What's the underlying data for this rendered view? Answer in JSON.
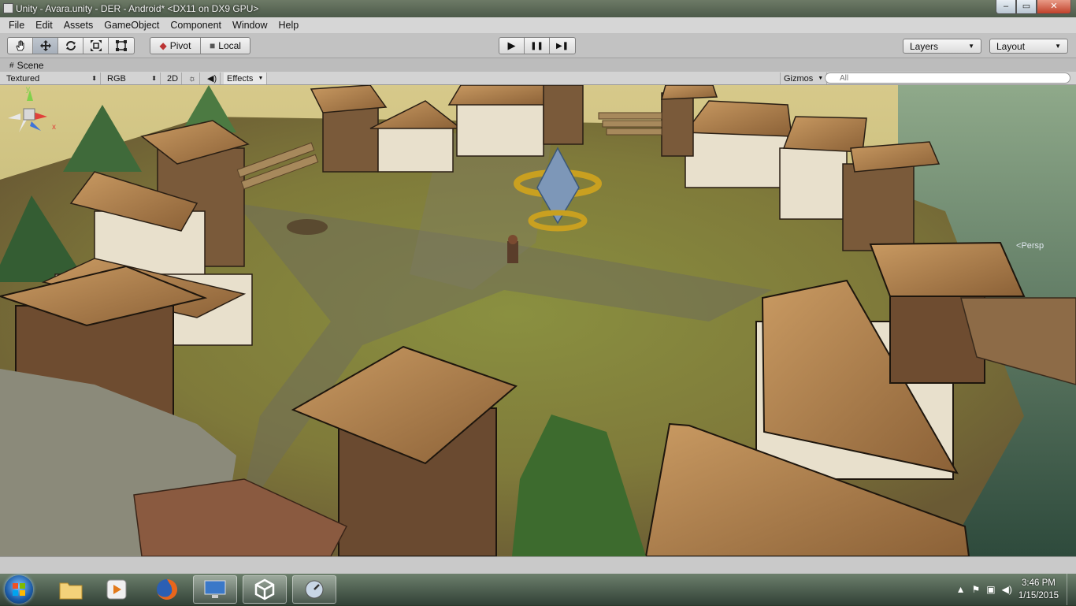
{
  "window": {
    "title": "Unity - Avara.unity - DER - Android* <DX11 on DX9 GPU>",
    "minimize": "–",
    "maximize": "▭",
    "close": "✕"
  },
  "menu": [
    "File",
    "Edit",
    "Assets",
    "GameObject",
    "Component",
    "Window",
    "Help"
  ],
  "toolbar": {
    "transform_tools": [
      "hand-icon",
      "move-icon",
      "rotate-icon",
      "scale-icon",
      "rect-icon"
    ],
    "pivot_label": "Pivot",
    "local_label": "Local",
    "play_icon": "▶",
    "pause_icon": "❚❚",
    "step_icon": "▶❚",
    "layers_label": "Layers",
    "layout_label": "Layout"
  },
  "scene": {
    "tab_label": "Scene",
    "render_mode": "Textured",
    "color_mode": "RGB",
    "mode_2d": "2D",
    "effects_label": "Effects",
    "gizmos_label": "Gizmos",
    "search_placeholder": "All",
    "persp_label": "Persp",
    "gizmo_x": "x",
    "gizmo_y": "y"
  },
  "taskbar": {
    "items": [
      "windows-explorer",
      "media-player",
      "firefox",
      "remote-desktop",
      "unity",
      "unity-remote"
    ],
    "time": "3:46 PM",
    "date": "1/15/2015"
  }
}
